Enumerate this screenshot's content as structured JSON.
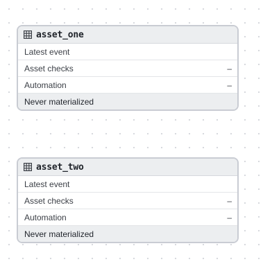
{
  "canvas": {
    "nodes": [
      {
        "title": "asset_one",
        "icon": "table-icon",
        "rows": [
          {
            "label": "Latest event",
            "value": ""
          },
          {
            "label": "Asset checks",
            "value": "–"
          },
          {
            "label": "Automation",
            "value": "–"
          }
        ],
        "status": "Never materialized"
      },
      {
        "title": "asset_two",
        "icon": "table-icon",
        "rows": [
          {
            "label": "Latest event",
            "value": ""
          },
          {
            "label": "Asset checks",
            "value": "–"
          },
          {
            "label": "Automation",
            "value": "–"
          }
        ],
        "status": "Never materialized"
      }
    ]
  },
  "colors": {
    "node_border": "#c9ccd3",
    "header_bg": "#eceef0",
    "canvas_dot": "#d7d9de"
  }
}
